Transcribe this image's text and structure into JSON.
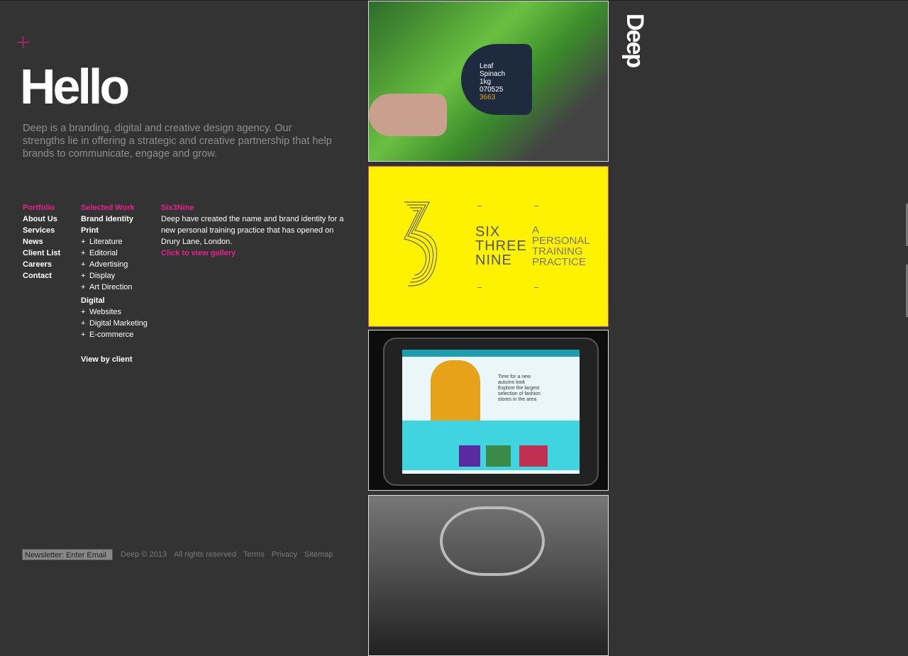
{
  "heading": "Hello",
  "intro": "Deep is a branding, digital and creative design agency. Our strengths lie in offering a strategic and creative partnership that help brands to communicate, engage and grow.",
  "logo": "Deep",
  "nav": {
    "primary": [
      "Portfolio",
      "About Us",
      "Services",
      "News",
      "Client List",
      "Careers",
      "Contact"
    ],
    "selected_work": "Selected Work",
    "brand_identity": "Brand Identity",
    "print": "Print",
    "print_items": [
      "Literature",
      "Editorial",
      "Advertising",
      "Display",
      "Art Direction"
    ],
    "digital": "Digital",
    "digital_items": [
      "Websites",
      "Digital Marketing",
      "E-commerce"
    ],
    "view_by_client": "View by client"
  },
  "project": {
    "title": "Six3Nine",
    "description": "Deep have created the name and brand identity for a new personal training practice that has opened on Drury Lane, London.",
    "gallery_link": "Click to view gallery"
  },
  "tiles": {
    "spinach": {
      "line1": "Leaf",
      "line2": "Spinach",
      "line3": "1kg",
      "line4": "070525",
      "line5": "3663"
    },
    "sixthreenine": {
      "name": [
        "SIX",
        "THREE",
        "NINE"
      ],
      "tag": [
        "A",
        "PERSONAL",
        "TRAINING",
        "PRACTICE"
      ]
    },
    "ipad": {
      "tagline": [
        "Time for a new",
        "autumn look",
        "Explore the largest",
        "selection of fashion",
        "stores in the area"
      ]
    }
  },
  "footer": {
    "newsletter_placeholder": "Newsletter: Enter Email",
    "copyright": "Deep © 2013",
    "rights": "All rights reserved",
    "terms": "Terms",
    "privacy": "Privacy",
    "sitemap": "Sitemap"
  },
  "colors": {
    "accent": "#e8208f",
    "background": "#333333",
    "muted_text": "#8e8e8e"
  }
}
